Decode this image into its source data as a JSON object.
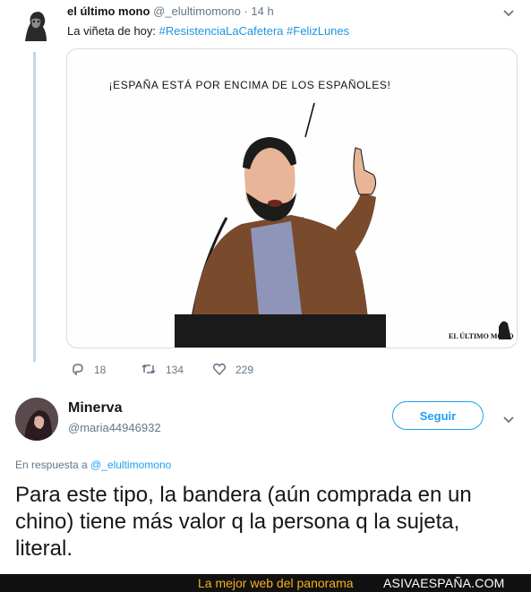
{
  "tweet": {
    "display_name": "el último mono",
    "handle": "@_elultimomono",
    "separator": "·",
    "time": "14 h",
    "text_prefix": "La viñeta de hoy:",
    "hashtags": [
      "#ResistenciaLaCafetera",
      "#FelizLunes"
    ],
    "image": {
      "speech_text": "¡ESPAÑA ESTÁ POR ENCIMA DE LOS ESPAÑOLES!",
      "signature": "EL ÚLTIMO MONO"
    },
    "actions": {
      "replies": "18",
      "retweets": "134",
      "likes": "229"
    }
  },
  "reply": {
    "display_name": "Minerva",
    "handle": "@maria44946932",
    "follow_label": "Seguir",
    "in_reply_prefix": "En respuesta a",
    "in_reply_handle": "@_elultimomono",
    "text": "Para este tipo, la bandera (aún comprada en un chino) tiene más valor q la persona q la sujeta, literal."
  },
  "footer": {
    "tagline": "La mejor web del panorama",
    "site": "ASIVAESPAÑA.COM"
  },
  "colors": {
    "link": "#1b95e0",
    "follow": "#1da1f2",
    "muted": "#657786",
    "thread_line": "#c6d7e4",
    "banner_bg": "#111111",
    "banner_tagline": "#f6b01c"
  }
}
